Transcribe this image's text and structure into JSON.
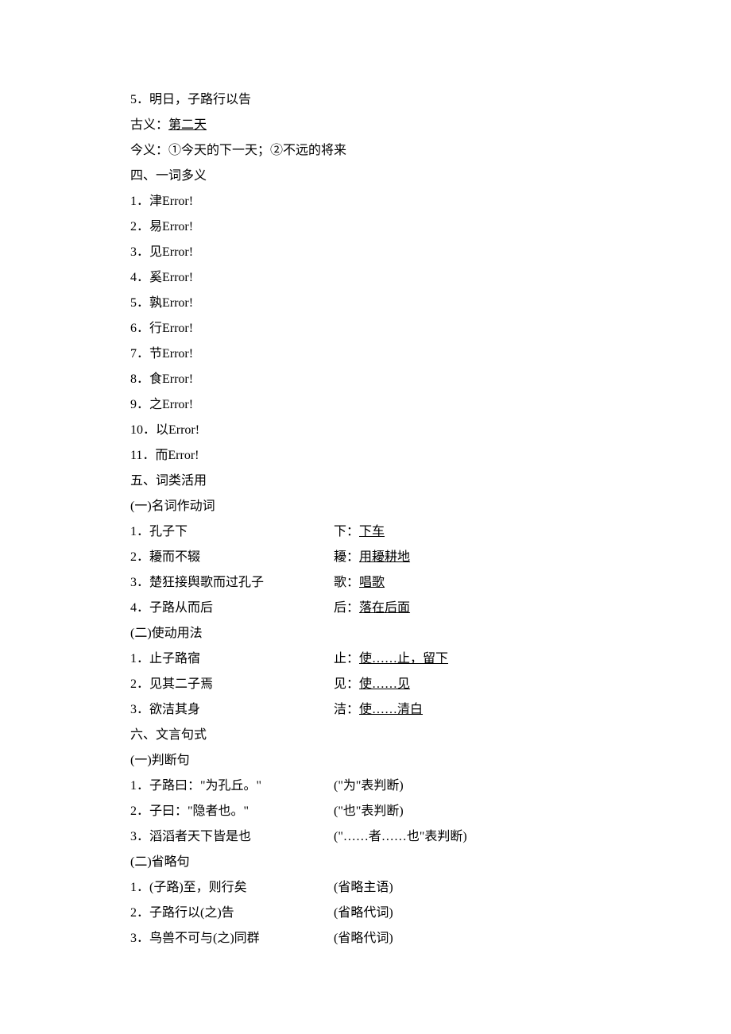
{
  "lines": [
    {
      "type": "single",
      "text": "5．明日，子路行以告"
    },
    {
      "type": "labeled",
      "label": "古义：",
      "underlined": "第二天"
    },
    {
      "type": "single",
      "text": "今义：①今天的下一天；②不远的将来"
    },
    {
      "type": "single",
      "text": "四、一词多义"
    },
    {
      "type": "single",
      "text": "1．津Error!"
    },
    {
      "type": "single",
      "text": "2．易Error!"
    },
    {
      "type": "single",
      "text": "3．见Error!"
    },
    {
      "type": "single",
      "text": "4．奚Error!"
    },
    {
      "type": "single",
      "text": "5．孰Error!"
    },
    {
      "type": "single",
      "text": "6．行Error!"
    },
    {
      "type": "single",
      "text": "7．节Error!"
    },
    {
      "type": "single",
      "text": "8．食Error!"
    },
    {
      "type": "single",
      "text": "9．之Error!"
    },
    {
      "type": "single",
      "text": "10．以Error!"
    },
    {
      "type": "single",
      "text": "11．而Error!"
    },
    {
      "type": "single",
      "text": "五、词类活用"
    },
    {
      "type": "single",
      "text": "(一)名词作动词"
    },
    {
      "type": "two-col",
      "left": "1．孔子下",
      "rightLabel": "下：",
      "rightUnderlined": "下车"
    },
    {
      "type": "two-col",
      "left": "2．耰而不辍",
      "rightLabel": "耰：",
      "rightUnderlined": "用耰耕地"
    },
    {
      "type": "two-col",
      "left": "3．楚狂接舆歌而过孔子",
      "rightLabel": "歌：",
      "rightUnderlined": "唱歌"
    },
    {
      "type": "two-col",
      "left": "4．子路从而后",
      "rightLabel": "后：",
      "rightUnderlined": "落在后面"
    },
    {
      "type": "single",
      "text": "(二)使动用法"
    },
    {
      "type": "two-col",
      "left": "1．止子路宿",
      "rightLabel": "止：",
      "rightUnderlined": "使……止，留下"
    },
    {
      "type": "two-col",
      "left": "2．见其二子焉",
      "rightLabel": "见：",
      "rightUnderlined": "使……见"
    },
    {
      "type": "two-col",
      "left": "3．欲洁其身",
      "rightLabel": "洁：",
      "rightUnderlined": "使……清白"
    },
    {
      "type": "single",
      "text": "六、文言句式"
    },
    {
      "type": "single",
      "text": "(一)判断句"
    },
    {
      "type": "two-col-plain",
      "left": "1．子路曰：\"为孔丘。\"",
      "right": "(\"为\"表判断)"
    },
    {
      "type": "two-col-plain",
      "left": "2．子曰：\"隐者也。\"",
      "right": "(\"也\"表判断)"
    },
    {
      "type": "two-col-plain",
      "left": "3．滔滔者天下皆是也",
      "right": "(\"……者……也\"表判断)"
    },
    {
      "type": "single",
      "text": "(二)省略句"
    },
    {
      "type": "two-col-plain",
      "left": "1．(子路)至，则行矣",
      "right": "(省略主语)"
    },
    {
      "type": "two-col-plain",
      "left": "2．子路行以(之)告",
      "right": "(省略代词)"
    },
    {
      "type": "two-col-plain",
      "left": "3．鸟兽不可与(之)同群",
      "right": "(省略代词)"
    }
  ]
}
